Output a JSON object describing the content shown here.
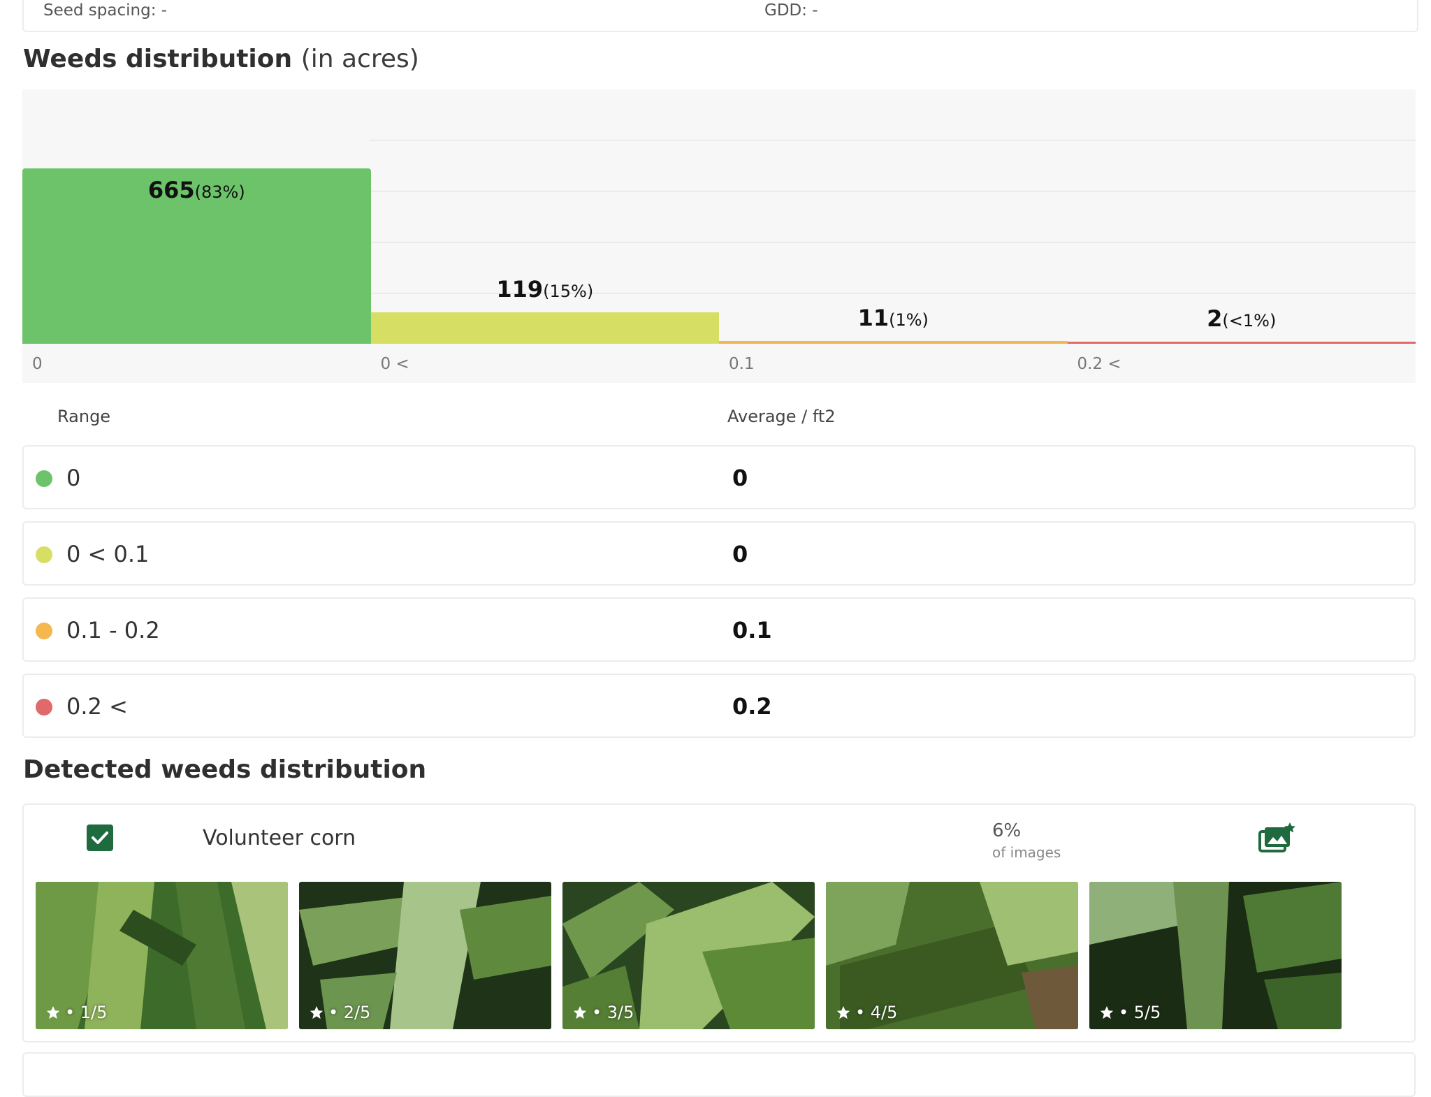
{
  "top_info": {
    "seed_spacing": "Seed spacing: -",
    "gdd": "GDD: -"
  },
  "weeds_distribution": {
    "title": "Weeds distribution",
    "subtitle": "(in acres)",
    "chart_data": {
      "type": "bar",
      "categories": [
        "0",
        "0 < 0.1",
        "0.1 - 0.2",
        "0.2 <"
      ],
      "values": [
        665,
        119,
        11,
        2
      ],
      "percent_labels": [
        "(83%)",
        "(15%)",
        "(1%)",
        "(<1%)"
      ],
      "value_labels": [
        "665",
        "119",
        "11",
        "2"
      ],
      "tick_labels": [
        "0",
        "0 <",
        "0.1",
        "0.2 <"
      ],
      "colors": [
        "#6cc36a",
        "#d6df64",
        "#f5b74e",
        "#e06a6a"
      ],
      "ylim": [
        0,
        800
      ],
      "grid": true
    }
  },
  "range_table": {
    "headers": {
      "range": "Range",
      "average": "Average / ft2"
    },
    "rows": [
      {
        "label": "0",
        "value": "0",
        "color": "#6cc36a"
      },
      {
        "label": "0 < 0.1",
        "value": "0",
        "color": "#d6df64"
      },
      {
        "label": "0.1 - 0.2",
        "value": "0.1",
        "color": "#f5b74e"
      },
      {
        "label": "0.2 <",
        "value": "0.2",
        "color": "#e06a6a"
      }
    ]
  },
  "detected": {
    "title": "Detected weeds distribution",
    "weed": {
      "name": "Volunteer corn",
      "checked": true,
      "share_value": "6%",
      "share_label": "of images",
      "gallery_icon": "gallery-star-icon",
      "thumbnails": [
        {
          "caption": "• 1/5",
          "icon": "star-icon"
        },
        {
          "caption": "• 2/5",
          "icon": "star-icon"
        },
        {
          "caption": "• 3/5",
          "icon": "star-icon"
        },
        {
          "caption": "• 4/5",
          "icon": "star-icon"
        },
        {
          "caption": "• 5/5",
          "icon": "star-icon"
        }
      ]
    }
  },
  "colors": {
    "accent": "#1f6a3e",
    "card_border": "#ececec",
    "chart_bg": "#f7f7f7"
  }
}
